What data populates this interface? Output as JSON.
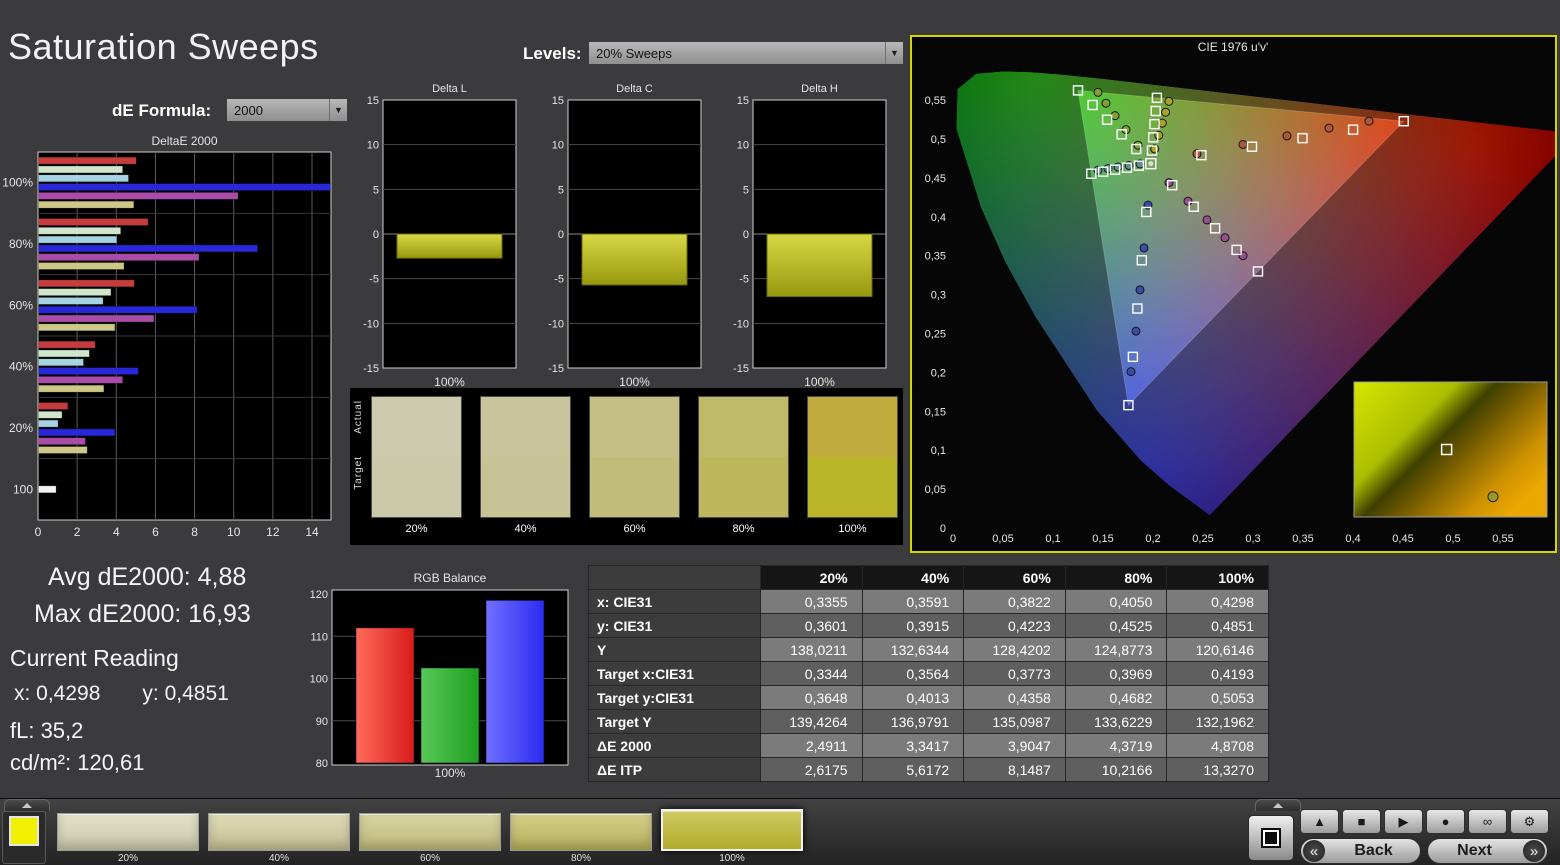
{
  "page": {
    "title": "Saturation Sweeps",
    "de_formula": {
      "label": "dE Formula:",
      "value": "2000"
    },
    "levels": {
      "label": "Levels:",
      "value": "20% Sweeps"
    },
    "dropdown_arrow": "▼"
  },
  "stats": {
    "avg": "Avg dE2000: 4,88",
    "max": "Max dE2000: 16,93",
    "current_reading": "Current Reading",
    "x": "x: 0,4298",
    "y": "y: 0,4851",
    "fl": "fL: 35,2",
    "cd": "cd/m²: 120,61"
  },
  "swatch_panel": {
    "row_labels": [
      "Actual",
      "Target"
    ],
    "swatches": [
      {
        "label": "20%",
        "actual": "#cdc9ad",
        "target": "#ccc8aa"
      },
      {
        "label": "40%",
        "actual": "#c9c49b",
        "target": "#c8c396"
      },
      {
        "label": "60%",
        "actual": "#c5bf85",
        "target": "#c3bd7c"
      },
      {
        "label": "80%",
        "actual": "#c0b968",
        "target": "#bdb65c"
      },
      {
        "label": "100%",
        "actual": "#c0ab3e",
        "target": "#b9b428"
      }
    ]
  },
  "table": {
    "header": [
      "",
      "20%",
      "40%",
      "60%",
      "80%",
      "100%"
    ],
    "rows": [
      {
        "label": "x: CIE31",
        "values": [
          "0,3355",
          "0,3591",
          "0,3822",
          "0,4050",
          "0,4298"
        ]
      },
      {
        "label": "y: CIE31",
        "values": [
          "0,3601",
          "0,3915",
          "0,4223",
          "0,4525",
          "0,4851"
        ]
      },
      {
        "label": "Y",
        "values": [
          "138,0211",
          "132,6344",
          "128,4202",
          "124,8773",
          "120,6146"
        ]
      },
      {
        "label": "Target x:CIE31",
        "values": [
          "0,3344",
          "0,3564",
          "0,3773",
          "0,3969",
          "0,4193"
        ]
      },
      {
        "label": "Target y:CIE31",
        "values": [
          "0,3648",
          "0,4013",
          "0,4358",
          "0,4682",
          "0,5053"
        ]
      },
      {
        "label": "Target Y",
        "values": [
          "139,4264",
          "136,9791",
          "135,0987",
          "133,6229",
          "132,1962"
        ]
      },
      {
        "label": "ΔE 2000",
        "values": [
          "2,4911",
          "3,3417",
          "3,9047",
          "4,3719",
          "4,8708"
        ]
      },
      {
        "label": "ΔE ITP",
        "values": [
          "2,6175",
          "5,6172",
          "8,1487",
          "10,2166",
          "13,3270"
        ]
      }
    ]
  },
  "bottom_bar": {
    "color_chip": "#f0f000",
    "swatches": [
      {
        "label": "20%",
        "color": "#dad7b8",
        "selected": false
      },
      {
        "label": "40%",
        "color": "#d3cfa0",
        "selected": false
      },
      {
        "label": "60%",
        "color": "#cdc884",
        "selected": false
      },
      {
        "label": "80%",
        "color": "#c6bf63",
        "selected": false
      },
      {
        "label": "100%",
        "color": "#c1b92f",
        "selected": true
      }
    ],
    "transport": [
      {
        "name": "eject",
        "glyph": "▲"
      },
      {
        "name": "stop",
        "glyph": "■"
      },
      {
        "name": "play",
        "glyph": "▶"
      },
      {
        "name": "record",
        "glyph": "●"
      },
      {
        "name": "continuous",
        "glyph": "∞"
      },
      {
        "name": "settings",
        "glyph": "⚙"
      }
    ],
    "back": {
      "glyph": "«",
      "label": "Back"
    },
    "next": {
      "glyph": "»",
      "label": "Next"
    }
  },
  "chart_data": [
    {
      "id": "deltae2000",
      "type": "bar",
      "orientation": "horizontal",
      "title": "DeltaE 2000",
      "xlim": [
        0,
        14
      ],
      "xticks": [
        0,
        2,
        4,
        6,
        8,
        10,
        12,
        14
      ],
      "groups": [
        "100%",
        "80%",
        "60%",
        "40%",
        "20%",
        "100"
      ],
      "series": [
        {
          "name": "Red",
          "color": "#c43c3c",
          "values": [
            5.0,
            5.6,
            4.9,
            2.9,
            1.5,
            null
          ]
        },
        {
          "name": "Green",
          "color": "#cfe6cc",
          "values": [
            4.3,
            4.2,
            3.7,
            2.6,
            1.2,
            null
          ]
        },
        {
          "name": "Cyan",
          "color": "#a6d4e2",
          "values": [
            4.6,
            4.0,
            3.3,
            2.3,
            1.0,
            null
          ]
        },
        {
          "name": "Blue",
          "color": "#2828d8",
          "values": [
            16.93,
            11.2,
            8.1,
            5.1,
            3.9,
            null
          ]
        },
        {
          "name": "Magenta",
          "color": "#a84ca8",
          "values": [
            10.2,
            8.2,
            5.9,
            4.3,
            2.4,
            null
          ]
        },
        {
          "name": "Yellow",
          "color": "#cdc788",
          "values": [
            4.8708,
            4.3719,
            3.9047,
            3.3417,
            2.4911,
            null
          ]
        },
        {
          "name": "White",
          "color": "#f2f2f2",
          "values": [
            null,
            null,
            null,
            null,
            null,
            0.9
          ]
        }
      ]
    },
    {
      "id": "delta_l",
      "type": "bar",
      "title": "Delta L",
      "categories": [
        "100%"
      ],
      "values": [
        -2.7
      ],
      "ylim": [
        -15,
        15
      ],
      "yticks": [
        15,
        10,
        5,
        0,
        -5,
        -10,
        -15
      ],
      "bar_color": "#c8c82e"
    },
    {
      "id": "delta_c",
      "type": "bar",
      "title": "Delta C",
      "categories": [
        "100%"
      ],
      "values": [
        -5.7
      ],
      "ylim": [
        -15,
        15
      ],
      "yticks": [
        15,
        10,
        5,
        0,
        -5,
        -10,
        -15
      ],
      "bar_color": "#c8c82e"
    },
    {
      "id": "delta_h",
      "type": "bar",
      "title": "Delta H",
      "categories": [
        "100%"
      ],
      "values": [
        -7.0
      ],
      "ylim": [
        -15,
        15
      ],
      "yticks": [
        15,
        10,
        5,
        0,
        -5,
        -10,
        -15
      ],
      "bar_color": "#c8c82e"
    },
    {
      "id": "rgb_balance",
      "type": "bar",
      "title": "RGB Balance",
      "categories": [
        "Red",
        "Green",
        "Blue"
      ],
      "values": [
        112,
        102.5,
        118.5
      ],
      "colors": [
        "#d81c1c",
        "#1f9e1f",
        "#2b2bf0"
      ],
      "colors_light": [
        "#ff6a5a",
        "#58c858",
        "#7070ff"
      ],
      "ylim": [
        80,
        120
      ],
      "yticks": [
        80,
        90,
        100,
        110,
        120
      ],
      "xlabel": "100%"
    },
    {
      "id": "cie",
      "type": "scatter",
      "title": "CIE 1976 u'v'",
      "xlim": [
        0,
        0.6
      ],
      "ylim": [
        0,
        0.6
      ],
      "tick_values": [
        0,
        0.05,
        0.1,
        0.15,
        0.2,
        0.25,
        0.3,
        0.35,
        0.4,
        0.45,
        0.5,
        0.55
      ],
      "tick_labels": [
        "0",
        "0,05",
        "0,1",
        "0,15",
        "0,2",
        "0,25",
        "0,3",
        "0,35",
        "0,4",
        "0,45",
        "0,5",
        "0,55"
      ],
      "white_point": [
        0.1978,
        0.4683
      ],
      "gamut_triangle": {
        "red": [
          0.4507,
          0.5229
        ],
        "green": [
          0.125,
          0.5625
        ],
        "blue": [
          0.1754,
          0.1579
        ]
      },
      "spectral_locus": [
        [
          0.2568,
          0.0166
        ],
        [
          0.2161,
          0.0549
        ],
        [
          0.1877,
          0.0871
        ],
        [
          0.1441,
          0.151
        ],
        [
          0.0828,
          0.2708
        ],
        [
          0.0521,
          0.3427
        ],
        [
          0.0282,
          0.4117
        ],
        [
          0.0035,
          0.513
        ],
        [
          0.0046,
          0.5639
        ],
        [
          0.0231,
          0.5837
        ],
        [
          0.0501,
          0.5868
        ],
        [
          0.0792,
          0.5856
        ],
        [
          0.1127,
          0.5821
        ],
        [
          0.1531,
          0.5766
        ],
        [
          0.2026,
          0.5693
        ],
        [
          0.2623,
          0.5604
        ],
        [
          0.3315,
          0.5501
        ],
        [
          0.4034,
          0.5393
        ],
        [
          0.5202,
          0.5219
        ],
        [
          0.6005,
          0.5099
        ],
        [
          0.6234,
          0.5065
        ]
      ],
      "series": [
        {
          "name": "red",
          "measured_color": "#b05838",
          "targets": [
            [
              0.2484,
              0.4792
            ],
            [
              0.299,
              0.4901
            ],
            [
              0.3495,
              0.5011
            ],
            [
              0.4001,
              0.512
            ],
            [
              0.4507,
              0.5229
            ]
          ],
          "measured": [
            [
              0.244,
              0.481
            ],
            [
              0.29,
              0.493
            ],
            [
              0.334,
              0.504
            ],
            [
              0.376,
              0.514
            ],
            [
              0.416,
              0.523
            ]
          ]
        },
        {
          "name": "green",
          "measured_color": "#7fa42e",
          "targets": [
            [
              0.1832,
              0.4871
            ],
            [
              0.1687,
              0.506
            ],
            [
              0.1541,
              0.5248
            ],
            [
              0.1396,
              0.5437
            ],
            [
              0.125,
              0.5625
            ]
          ],
          "measured": [
            [
              0.185,
              0.492
            ],
            [
              0.173,
              0.512
            ],
            [
              0.162,
              0.53
            ],
            [
              0.153,
              0.546
            ],
            [
              0.145,
              0.56
            ]
          ]
        },
        {
          "name": "blue",
          "measured_color": "#3a4ba8",
          "targets": [
            [
              0.1933,
              0.4062
            ],
            [
              0.1888,
              0.3441
            ],
            [
              0.1844,
              0.2821
            ],
            [
              0.1799,
              0.22
            ],
            [
              0.1754,
              0.1579
            ]
          ],
          "measured": [
            [
              0.195,
              0.415
            ],
            [
              0.191,
              0.36
            ],
            [
              0.187,
              0.306
            ],
            [
              0.183,
              0.253
            ],
            [
              0.178,
              0.201
            ]
          ]
        },
        {
          "name": "cyan",
          "measured_color": "#5f9090",
          "targets": [
            [
              0.1859,
              0.4657
            ],
            [
              0.174,
              0.4631
            ],
            [
              0.1621,
              0.4606
            ],
            [
              0.1502,
              0.458
            ],
            [
              0.1383,
              0.4554
            ]
          ],
          "measured": [
            [
              0.187,
              0.468
            ],
            [
              0.176,
              0.466
            ],
            [
              0.165,
              0.464
            ],
            [
              0.155,
              0.462
            ],
            [
              0.145,
              0.46
            ]
          ]
        },
        {
          "name": "magenta",
          "measured_color": "#96508f",
          "targets": [
            [
              0.2192,
              0.4406
            ],
            [
              0.2407,
              0.4129
            ],
            [
              0.2621,
              0.3852
            ],
            [
              0.2836,
              0.3575
            ],
            [
              0.305,
              0.3298
            ]
          ],
          "measured": [
            [
              0.216,
              0.444
            ],
            [
              0.235,
              0.42
            ],
            [
              0.254,
              0.396
            ],
            [
              0.272,
              0.373
            ],
            [
              0.29,
              0.35
            ]
          ]
        },
        {
          "name": "yellow",
          "measured_color": "#a8a226",
          "targets": [
            [
              0.199,
              0.4852
            ],
            [
              0.2002,
              0.5021
            ],
            [
              0.2015,
              0.5191
            ],
            [
              0.2027,
              0.536
            ],
            [
              0.2039,
              0.5529
            ]
          ],
          "measured": [
            [
              0.2018,
              0.4873
            ],
            [
              0.2058,
              0.5048
            ],
            [
              0.2093,
              0.5204
            ],
            [
              0.2126,
              0.5344
            ],
            [
              0.2159,
              0.5484
            ]
          ]
        }
      ],
      "inset": {
        "square_pos": [
          0.48,
          0.5
        ],
        "circle_pos": [
          0.72,
          0.85
        ]
      }
    }
  ]
}
